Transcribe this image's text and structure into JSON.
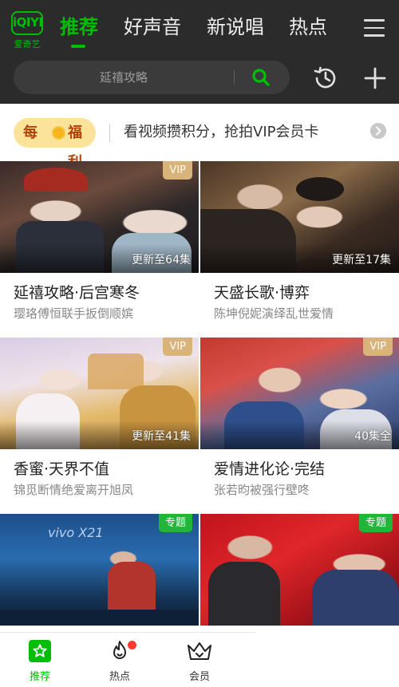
{
  "header": {
    "logo_mark": "iQIYI",
    "logo_text": "爱奇艺",
    "tabs": [
      {
        "label": "推荐",
        "active": true
      },
      {
        "label": "好声音",
        "active": false
      },
      {
        "label": "新说唱",
        "active": false
      },
      {
        "label": "热点",
        "active": false
      }
    ],
    "menu_icon": "menu-icon"
  },
  "search": {
    "placeholder": "延禧攻略",
    "icon": "search-icon"
  },
  "toolbar": {
    "history_icon": "history-icon",
    "add_icon": "plus-icon"
  },
  "banner": {
    "badge_left": "每",
    "badge_right": "福利",
    "text": "看视频攒积分，抢拍VIP会员卡",
    "arrow_icon": "chevron-right-icon"
  },
  "cards": [
    {
      "title": "延禧攻略·后宫寒冬",
      "desc": "璎珞傅恒联手扳倒顺嫔",
      "tag": "VIP",
      "caption": "更新至64集"
    },
    {
      "title": "天盛长歌·博弈",
      "desc": "陈坤倪妮演绎乱世爱情",
      "tag": "VIP",
      "caption": "更新至17集"
    },
    {
      "title": "香蜜·天界不值",
      "desc": "锦觅断情绝爱离开旭凤",
      "tag": "VIP",
      "caption": "更新至41集"
    },
    {
      "title": "爱情进化论·完结",
      "desc": "张若昀被强行壁咚",
      "tag": "VIP",
      "caption": "40集全"
    },
    {
      "tag": "专题",
      "thumb_text": "vivo X21"
    },
    {
      "tag": "专题"
    }
  ],
  "bottom_nav": [
    {
      "label": "推荐",
      "icon": "star-icon",
      "active": true
    },
    {
      "label": "热点",
      "icon": "flame-icon",
      "active": false,
      "badge": "red-dot"
    },
    {
      "label": "会员",
      "icon": "crown-icon",
      "active": false
    }
  ],
  "colors": {
    "brand_green": "#00be06",
    "header_bg": "#2b2b2b",
    "vip_gold": "#d8b37a",
    "topic_green": "#21b63a"
  }
}
